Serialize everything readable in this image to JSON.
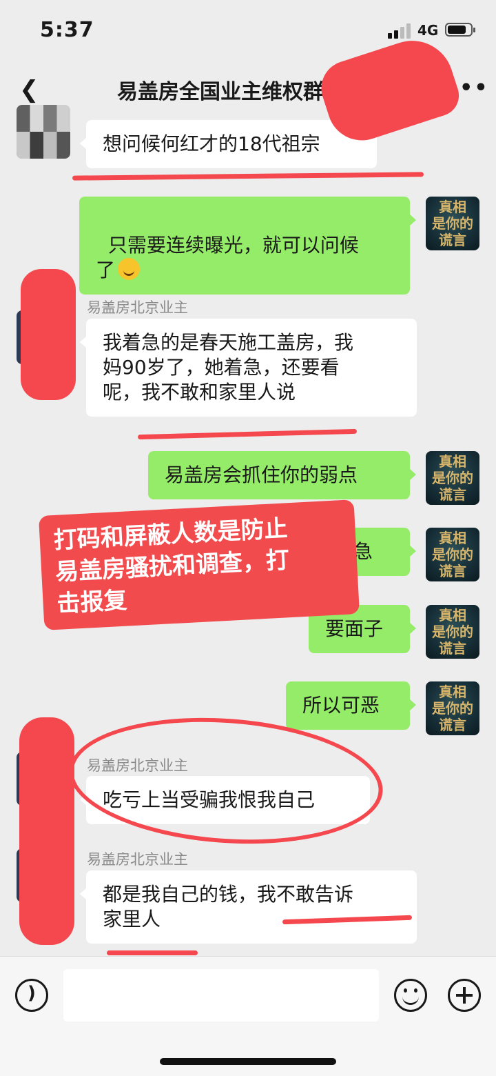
{
  "status": {
    "time": "5:37",
    "network": "4G"
  },
  "header": {
    "back_icon": "chevron-left-icon",
    "title": "易盖房全国业主维权群",
    "more_icon": "more-icon"
  },
  "self_avatar_text": "真相\n是你的\n谎言",
  "messages": [
    {
      "side": "left",
      "sender": "",
      "text": "想问候何红才的18代祖宗"
    },
    {
      "side": "right",
      "text": "只需要连续曝光，就可以问候\n了",
      "emoji": "grinning-face"
    },
    {
      "side": "left",
      "sender": "易盖房北京业主",
      "text": "我着急的是春天施工盖房，我\n妈90岁了，她着急，还要看\n呢，我不敢和家里人说"
    },
    {
      "side": "right",
      "text": "易盖房会抓住你的弱点"
    },
    {
      "side": "right",
      "text": "就是着急"
    },
    {
      "side": "right",
      "text": "要面子"
    },
    {
      "side": "right",
      "text": "所以可恶"
    },
    {
      "side": "left",
      "sender": "易盖房北京业主",
      "text": "吃亏上当受骗我恨我自己"
    },
    {
      "side": "left",
      "sender": "易盖房北京业主",
      "text": "都是我自己的钱，我不敢告诉\n家里人"
    }
  ],
  "overlay_note": "打码和屏蔽人数是防止\n易盖房骚扰和调查，打\n击报复",
  "input_bar": {
    "voice_icon": "voice-icon",
    "emoji_icon": "emoji-icon",
    "plus_icon": "plus-icon"
  },
  "colors": {
    "bg": "#ededed",
    "self_bubble": "#95ec69",
    "other_bubble": "#ffffff",
    "annotation_red": "#f4484e"
  }
}
